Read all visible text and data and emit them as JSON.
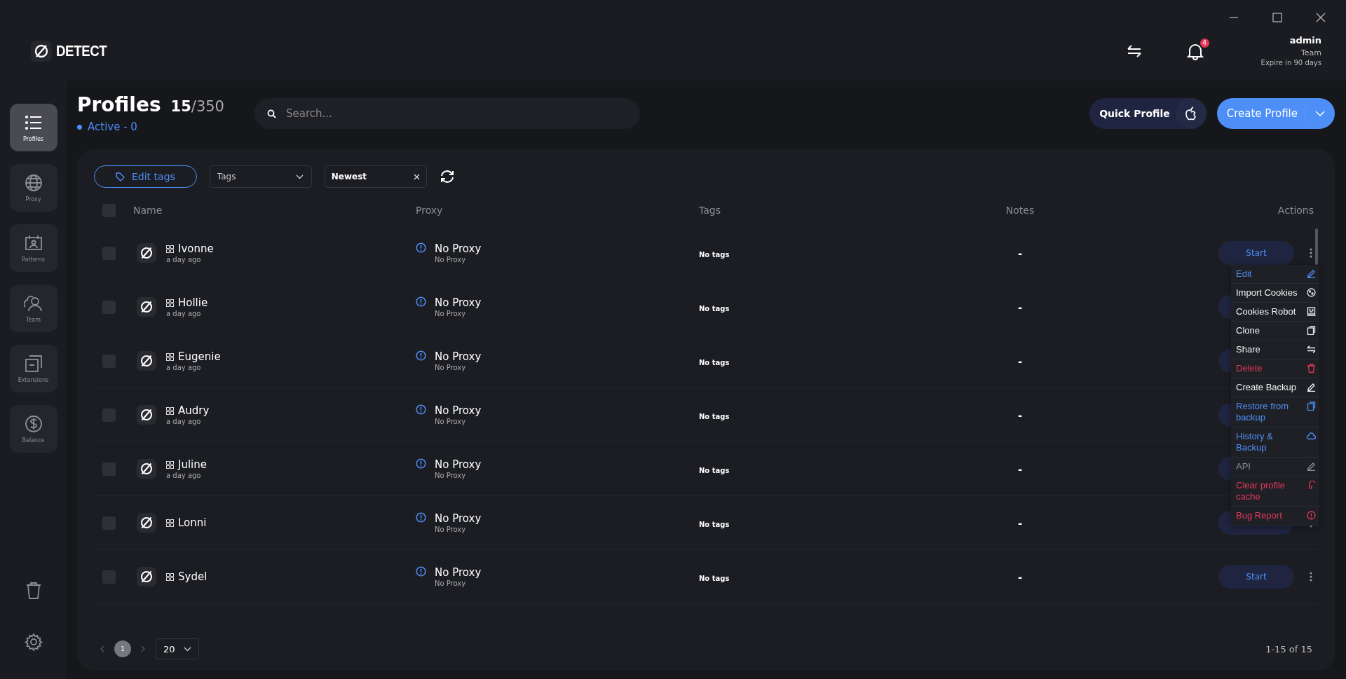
{
  "app": {
    "logo": "DETECT"
  },
  "header": {
    "notifications": "4",
    "user": {
      "name": "admin",
      "plan": "Team",
      "expiry": "Expire in 90 days"
    }
  },
  "sidebar": {
    "items": [
      {
        "label": "Profiles",
        "kind": "list",
        "selected": true
      },
      {
        "label": "Proxy",
        "kind": "globe",
        "selected": false
      },
      {
        "label": "Patterns",
        "kind": "calendar",
        "selected": false
      },
      {
        "label": "Team",
        "kind": "team",
        "selected": false
      },
      {
        "label": "Extensions",
        "kind": "extension",
        "selected": false
      },
      {
        "label": "Balance",
        "kind": "dollar",
        "selected": false
      }
    ]
  },
  "page": {
    "title": "Profiles",
    "count": "15",
    "limit": "/350",
    "active": "Active - 0",
    "search": {
      "placeholder": "Search..."
    },
    "quick_profile": "Quick Profile",
    "create_profile": "Create Profile"
  },
  "toolbar": {
    "edit_tags": "Edit tags",
    "tags_filter": {
      "placeholder": "Tags"
    },
    "sort": "Newest"
  },
  "table": {
    "all_checked": false,
    "columns": [
      "Name",
      "Proxy",
      "Tags",
      "Notes",
      "Actions"
    ],
    "rows": [
      {
        "name": "Ivonne",
        "created": "a day ago",
        "proxy": "No Proxy",
        "proxy_detail": "No Proxy",
        "tags": "No tags",
        "notes": "-",
        "action": "Start",
        "checked": false
      },
      {
        "name": "Hollie",
        "created": "a day ago",
        "proxy": "No Proxy",
        "proxy_detail": "No Proxy",
        "tags": "No tags",
        "notes": "-",
        "checked": false
      },
      {
        "name": "Eugenie",
        "created": "a day ago",
        "proxy": "No Proxy",
        "proxy_detail": "No Proxy",
        "tags": "No tags",
        "notes": "-",
        "checked": false
      },
      {
        "name": "Audry",
        "created": "a day ago",
        "proxy": "No Proxy",
        "proxy_detail": "No Proxy",
        "tags": "No tags",
        "notes": "-",
        "checked": false
      },
      {
        "name": "Juline",
        "created": "a day ago",
        "proxy": "No Proxy",
        "proxy_detail": "No Proxy",
        "tags": "No tags",
        "notes": "-",
        "checked": false
      },
      {
        "name": "Lonni",
        "proxy": "No Proxy",
        "proxy_detail": "No Proxy",
        "tags": "No tags",
        "notes": "-",
        "checked": false
      },
      {
        "name": "Sydel",
        "proxy": "No Proxy",
        "proxy_detail": "No Proxy",
        "tags": "No tags",
        "notes": "-",
        "action": "Start",
        "checked": false
      }
    ]
  },
  "context_menu": {
    "items": [
      {
        "label": "Edit",
        "color": "#4d8ef7",
        "kind": "pencil"
      },
      {
        "label": "Import Cookies",
        "color": "#f1f2f4",
        "kind": "cookie"
      },
      {
        "label": "Cookies Robot",
        "color": "#f1f2f4",
        "kind": "robot"
      },
      {
        "label": "Clone",
        "color": "#f1f2f4",
        "kind": "copy"
      },
      {
        "label": "Share",
        "color": "#f1f2f4",
        "kind": "swap"
      },
      {
        "label": "Delete",
        "color": "#e5385b",
        "kind": "trash"
      },
      {
        "label": "Create Backup",
        "color": "#f1f2f4",
        "kind": "pencil"
      },
      {
        "label": "Restore from backup",
        "color": "#4d8ef7",
        "kind": "copy"
      },
      {
        "label": "History & Backup",
        "color": "#4d8ef7",
        "kind": "cloud"
      },
      {
        "label": "API",
        "color": "#8a8c93",
        "kind": "pencil"
      },
      {
        "label": "Clear profile cache",
        "color": "#e5385b",
        "kind": "broom"
      },
      {
        "label": "Bug Report",
        "color": "#e5385b",
        "kind": "alert"
      }
    ]
  },
  "pagination": {
    "pages": [
      {
        "label": "1",
        "selected": true
      }
    ],
    "page_size": "20",
    "range": "1-15 of 15"
  }
}
